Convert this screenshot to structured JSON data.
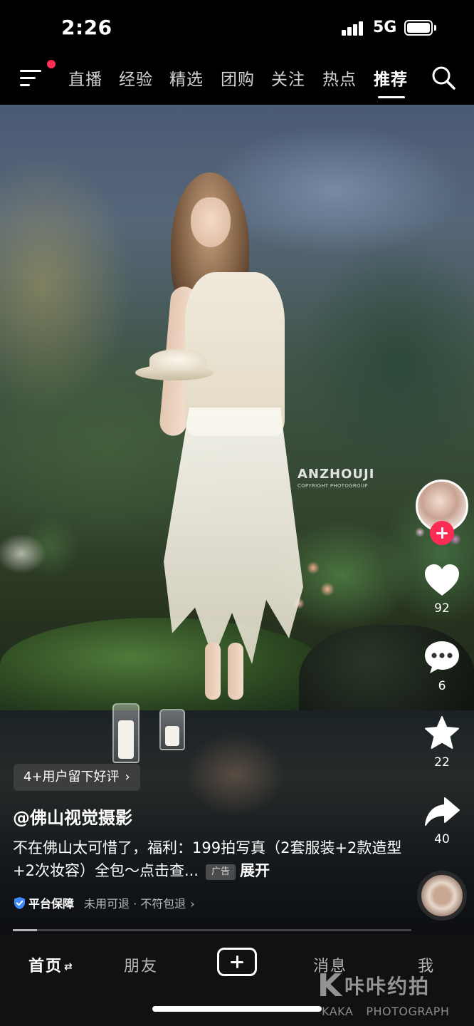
{
  "status_bar": {
    "time": "2:26",
    "network": "5G",
    "battery_level": 1.0
  },
  "top_nav": {
    "tabs": [
      {
        "label": "直播"
      },
      {
        "label": "经验"
      },
      {
        "label": "精选"
      },
      {
        "label": "团购"
      },
      {
        "label": "关注"
      },
      {
        "label": "热点"
      },
      {
        "label": "推荐",
        "active": true
      }
    ],
    "menu_icon": "menu-icon",
    "search_icon": "search-icon",
    "notification_dot_color": "#ff2d55"
  },
  "video": {
    "watermark_main": "ANZHOUJI",
    "watermark_sub": "COPYRIGHT PHOTOGROUP",
    "progress": 0.06
  },
  "actions": {
    "likes": "92",
    "comments": "6",
    "favorites": "22",
    "shares": "40",
    "follow_color": "#fe2c55"
  },
  "post": {
    "review_pill": "4+用户留下好评",
    "author": "@佛山视觉摄影",
    "caption": "不在佛山太可惜了，福利：199拍写真（2套服装+2款造型+2次妆容）全包～点击查...",
    "ad_label": "广告",
    "expand_label": "展开",
    "guarantee_title": "平台保障",
    "guarantee_desc": "未用可退 · 不符包退"
  },
  "bottom_tabs": {
    "home": "首页",
    "friends": "朋友",
    "messages": "消息",
    "me": "我"
  },
  "branding": {
    "k_mark": "K",
    "cn": "咔咔约拍",
    "en_1": "KAKA",
    "en_2": "PHOTOGRAPH"
  }
}
